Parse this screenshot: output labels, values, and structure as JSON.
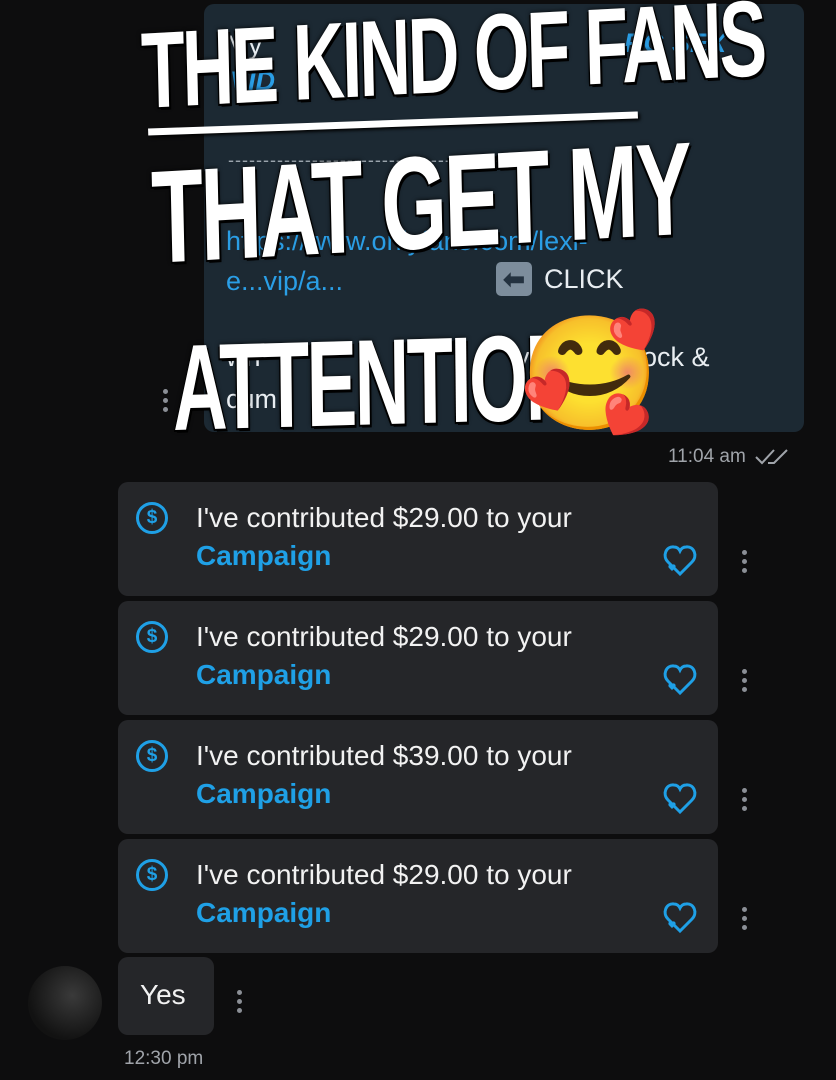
{
  "top_message": {
    "title_fragment": "My",
    "title_link_tail": "RG SEX",
    "title_link_line2": "VID",
    "dashes": "-------------------------------------------",
    "link_line1": "https://www.onlyfans.com/lexi-",
    "link_line2": "e...vip/a...",
    "click_label": "CLICK",
    "body_line1_a": "wh",
    "body_line1_b": "va",
    "body_line1_c": "ock &",
    "body_line2": "cum",
    "time": "11:04 am"
  },
  "overlay": {
    "line1": "THE KIND OF FANS",
    "line2": "THAT GET MY",
    "line3": "ATTENTION",
    "emoji": "🥰"
  },
  "contributions": [
    {
      "text": "I've contributed $29.00 to your",
      "link": "Campaign"
    },
    {
      "text": "I've contributed $29.00 to your",
      "link": "Campaign"
    },
    {
      "text": "I've contributed $39.00 to your",
      "link": "Campaign"
    },
    {
      "text": "I've contributed $29.00 to your",
      "link": "Campaign"
    }
  ],
  "reply": {
    "text": "Yes",
    "time": "12:30 pm"
  },
  "icons": {
    "dollar": "$",
    "accent": "#1fa0e6"
  }
}
